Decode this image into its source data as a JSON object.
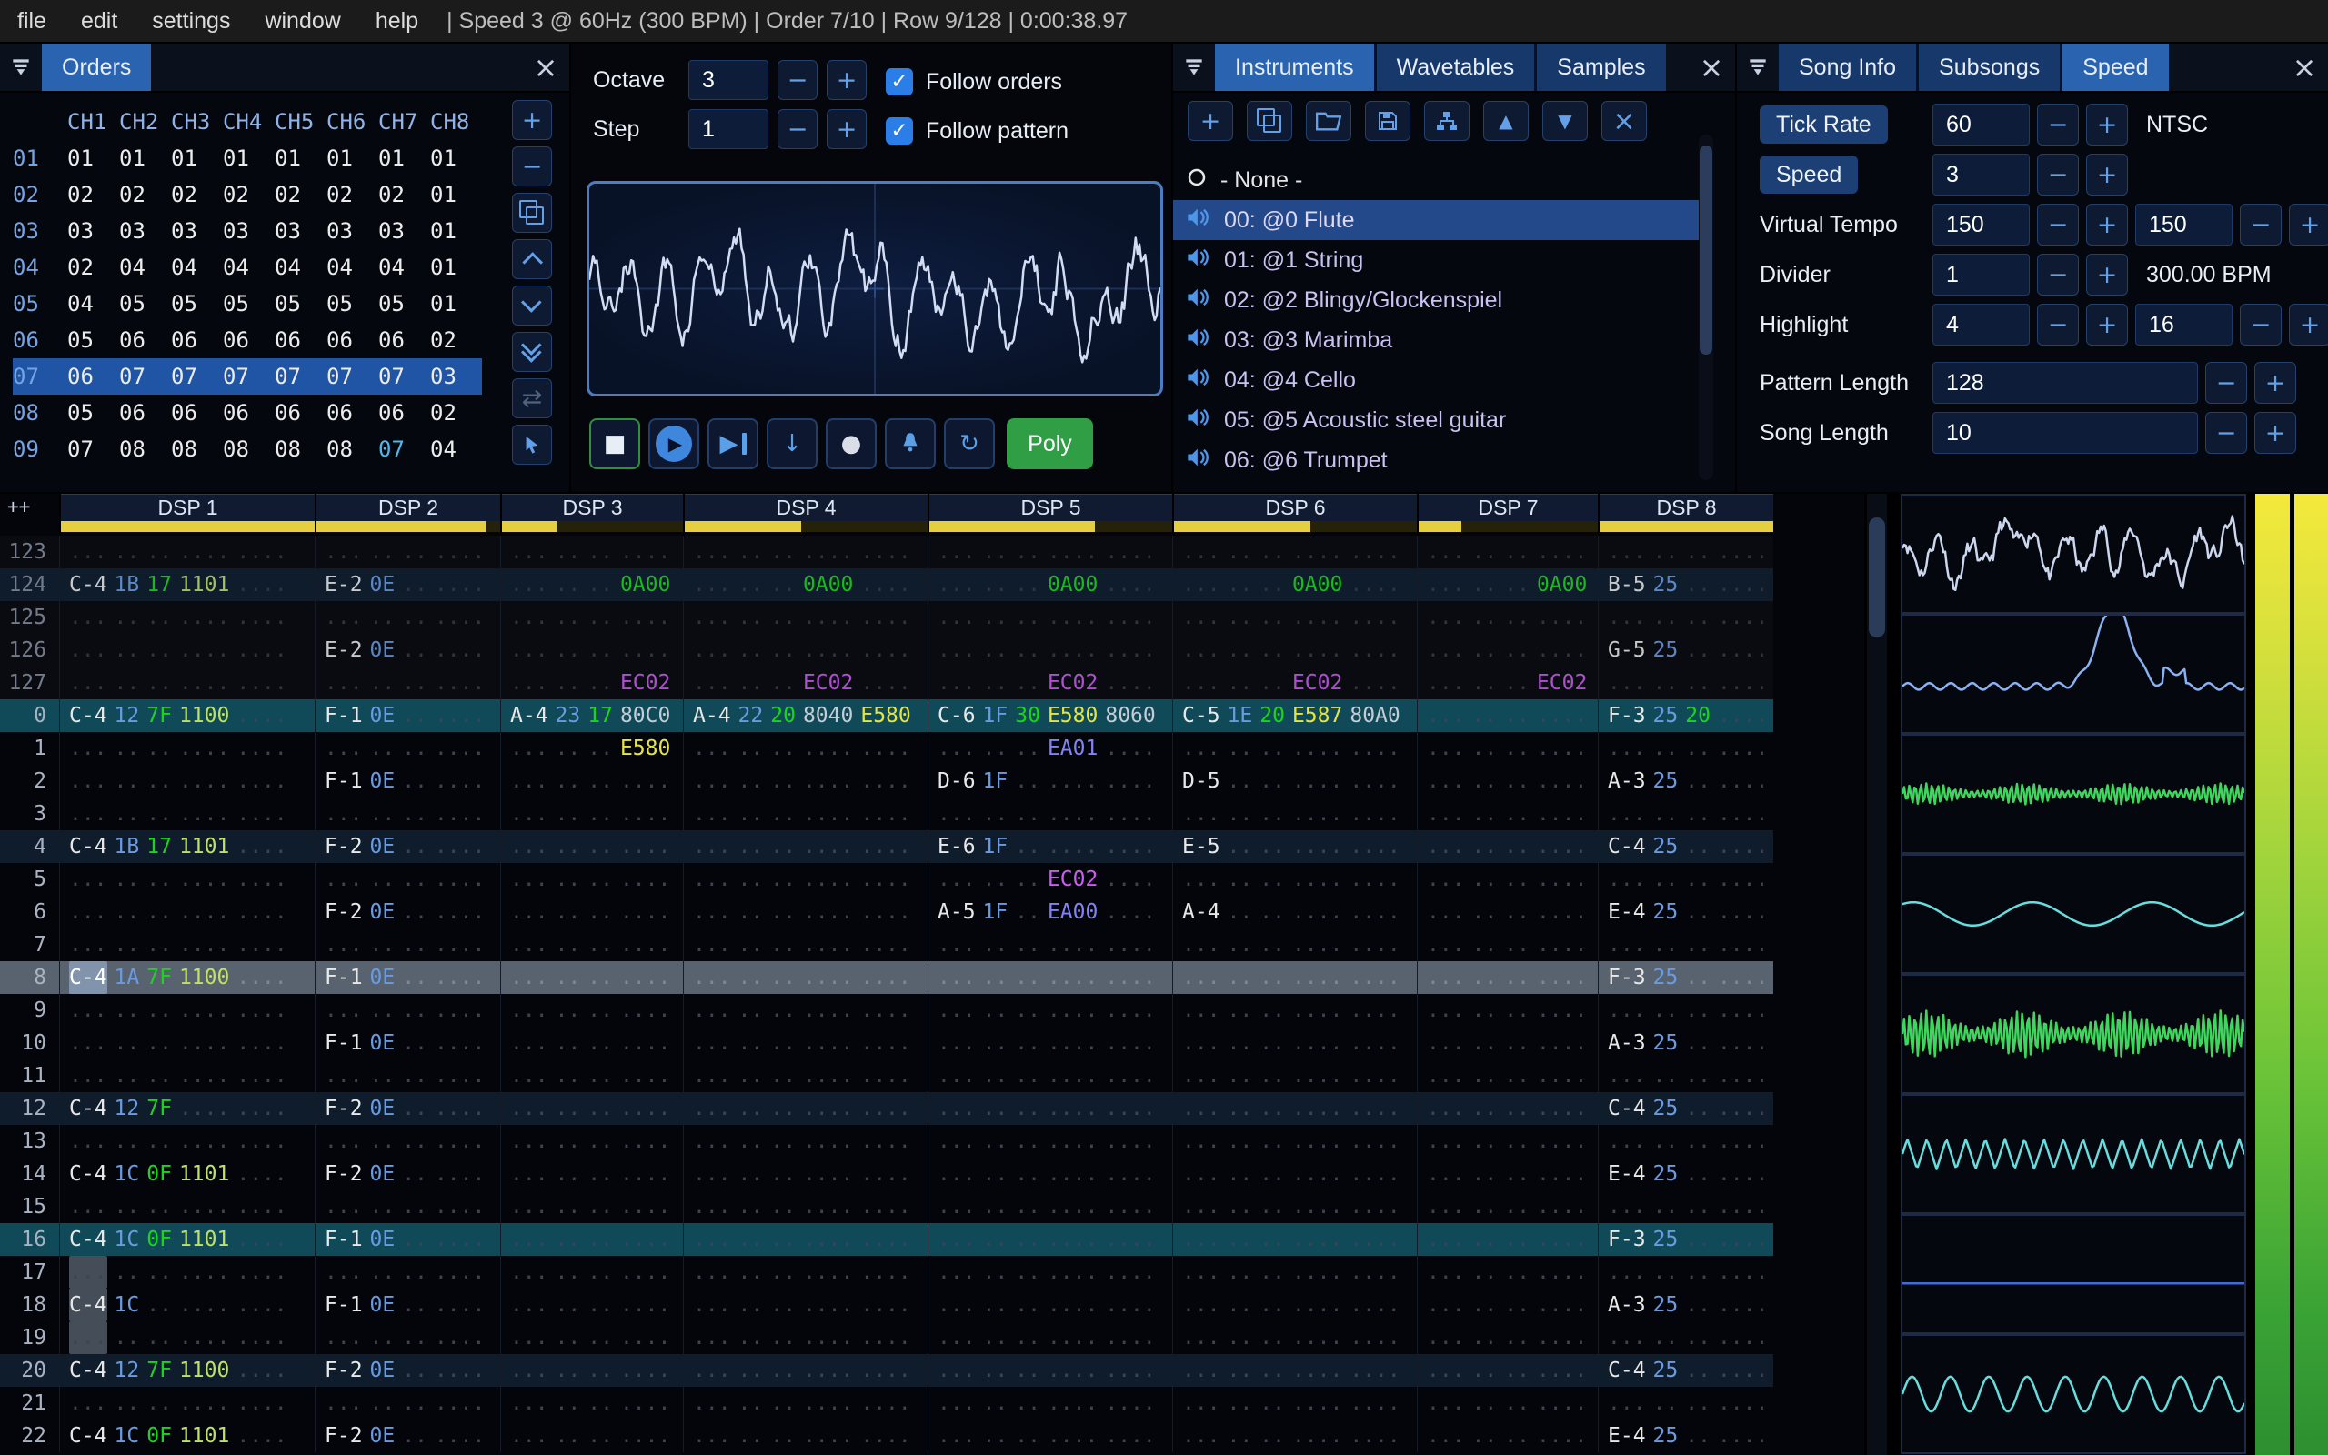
{
  "menu": {
    "items": [
      "file",
      "edit",
      "settings",
      "window",
      "help"
    ],
    "status": "| Speed 3 @ 60Hz (300 BPM) | Order 7/10 | Row 9/128 | 0:00:38.97"
  },
  "glyphs": {
    "plus": "+",
    "minus": "−",
    "check": "✓",
    "close": "×",
    "shuffle": "⇄",
    "up": "▲",
    "down": "▼",
    "stop": "■",
    "play": "▶",
    "step": "↓",
    "record": "●",
    "repeat": "↻"
  },
  "orders": {
    "tabs": [
      "Orders"
    ],
    "active_tab": 0,
    "channels": [
      "CH1",
      "CH2",
      "CH3",
      "CH4",
      "CH5",
      "CH6",
      "CH7",
      "CH8"
    ],
    "rows": [
      {
        "label": "01",
        "values": [
          "01",
          "01",
          "01",
          "01",
          "01",
          "01",
          "01",
          "01"
        ]
      },
      {
        "label": "02",
        "values": [
          "02",
          "02",
          "02",
          "02",
          "02",
          "02",
          "02",
          "01"
        ]
      },
      {
        "label": "03",
        "values": [
          "03",
          "03",
          "03",
          "03",
          "03",
          "03",
          "03",
          "01"
        ]
      },
      {
        "label": "04",
        "values": [
          "02",
          "04",
          "04",
          "04",
          "04",
          "04",
          "04",
          "01"
        ]
      },
      {
        "label": "05",
        "values": [
          "04",
          "05",
          "05",
          "05",
          "05",
          "05",
          "05",
          "01"
        ]
      },
      {
        "label": "06",
        "values": [
          "05",
          "06",
          "06",
          "06",
          "06",
          "06",
          "06",
          "02"
        ]
      },
      {
        "label": "07",
        "values": [
          "06",
          "07",
          "07",
          "07",
          "07",
          "07",
          "07",
          "03"
        ]
      },
      {
        "label": "08",
        "values": [
          "05",
          "06",
          "06",
          "06",
          "06",
          "06",
          "06",
          "02"
        ]
      },
      {
        "label": "09",
        "values": [
          "07",
          "08",
          "08",
          "08",
          "08",
          "08",
          "07",
          "04"
        ]
      }
    ],
    "selected_index": 6,
    "accent_cell": {
      "row": 8,
      "col": 6
    },
    "toolbar": [
      "add-order",
      "remove-order",
      "duplicate-order",
      "move-order-up",
      "move-order-down",
      "duplicate-order-end",
      "randomize-order",
      "order-edit-mode"
    ]
  },
  "playback": {
    "octave_label": "Octave",
    "octave_value": "3",
    "step_label": "Step",
    "step_value": "1",
    "follow_orders_label": "Follow orders",
    "follow_pattern_label": "Follow pattern",
    "poly_label": "Poly"
  },
  "instruments": {
    "tabs": [
      "Instruments",
      "Wavetables",
      "Samples"
    ],
    "active_tab": 0,
    "toolbar": [
      "add-instrument",
      "duplicate-instrument",
      "open-instrument",
      "save-instrument",
      "organize-instruments",
      "move-instrument-up",
      "move-instrument-down",
      "delete-instrument"
    ],
    "items": [
      {
        "name": "- None -",
        "icon": "circle",
        "selected": false
      },
      {
        "name": "00: @0 Flute",
        "icon": "speaker",
        "selected": true
      },
      {
        "name": "01: @1 String",
        "icon": "speaker",
        "selected": false
      },
      {
        "name": "02: @2 Blingy/Glockenspiel",
        "icon": "speaker",
        "selected": false
      },
      {
        "name": "03: @3 Marimba",
        "icon": "speaker",
        "selected": false
      },
      {
        "name": "04: @4 Cello",
        "icon": "speaker",
        "selected": false
      },
      {
        "name": "05: @5 Acoustic steel guitar",
        "icon": "speaker",
        "selected": false
      },
      {
        "name": "06: @6 Trumpet",
        "icon": "speaker",
        "selected": false
      }
    ]
  },
  "song_info": {
    "tabs": [
      "Song Info",
      "Subsongs",
      "Speed"
    ],
    "active_tab": 2,
    "rows": [
      {
        "label": "Tick Rate",
        "style": "button",
        "inputs": [
          "60"
        ],
        "suffix": "NTSC",
        "wide": false
      },
      {
        "label": "Speed",
        "style": "button",
        "inputs": [
          "3"
        ],
        "suffix": "",
        "wide": false
      },
      {
        "label": "Virtual Tempo",
        "style": "plain",
        "inputs": [
          "150",
          "150"
        ],
        "suffix": "",
        "wide": false
      },
      {
        "label": "Divider",
        "style": "plain",
        "inputs": [
          "1"
        ],
        "suffix": "300.00 BPM",
        "wide": false
      },
      {
        "label": "Highlight",
        "style": "plain",
        "inputs": [
          "4",
          "16"
        ],
        "suffix": "",
        "wide": false
      },
      {
        "label": "Pattern Length",
        "style": "plain",
        "inputs": [
          "128"
        ],
        "suffix": "",
        "wide": true
      },
      {
        "label": "Song Length",
        "style": "plain",
        "inputs": [
          "10"
        ],
        "suffix": "",
        "wide": true
      }
    ]
  },
  "pattern": {
    "corner": "++",
    "channels": [
      {
        "name": "DSP 1",
        "meter": 1.0
      },
      {
        "name": "DSP 2",
        "meter": 0.92
      },
      {
        "name": "DSP 3",
        "meter": 0.3
      },
      {
        "name": "DSP 4",
        "meter": 0.48
      },
      {
        "name": "DSP 5",
        "meter": 0.68
      },
      {
        "name": "DSP 6",
        "meter": 0.56
      },
      {
        "name": "DSP 7",
        "meter": 0.24
      },
      {
        "name": "DSP 8",
        "meter": 1.0
      }
    ],
    "rows": [
      {
        "n": "123",
        "prev": true,
        "cells": {}
      },
      {
        "n": "124",
        "prev": true,
        "hl": "min",
        "cells": {
          "0": [
            "C-4",
            "1B",
            "17",
            "1101",
            ""
          ],
          "1": [
            "E-2",
            "0E",
            "",
            ""
          ],
          "2": [
            "",
            "",
            "",
            "0A00"
          ],
          "3": [
            "",
            "",
            "",
            "0A00",
            ""
          ],
          "4": [
            "",
            "",
            "",
            "0A00",
            ""
          ],
          "5": [
            "",
            "",
            "",
            "0A00",
            ""
          ],
          "6": [
            "",
            "",
            "",
            "0A00"
          ],
          "7": [
            "B-5",
            "25",
            "",
            ""
          ]
        }
      },
      {
        "n": "125",
        "prev": true,
        "cells": {}
      },
      {
        "n": "126",
        "prev": true,
        "cells": {
          "1": [
            "E-2",
            "0E",
            "",
            ""
          ],
          "7": [
            "G-5",
            "25",
            "",
            ""
          ]
        }
      },
      {
        "n": "127",
        "prev": true,
        "cells": {
          "2": [
            "",
            "",
            "",
            "EC02"
          ],
          "3": [
            "",
            "",
            "",
            "EC02",
            ""
          ],
          "4": [
            "",
            "",
            "",
            "EC02",
            ""
          ],
          "5": [
            "",
            "",
            "",
            "EC02",
            ""
          ],
          "6": [
            "",
            "",
            "",
            "EC02"
          ]
        }
      },
      {
        "n": "0",
        "hl": "maj",
        "cells": {
          "0": [
            "C-4",
            "12",
            "7F",
            "1100",
            ""
          ],
          "1": [
            "F-1",
            "0E",
            "",
            ""
          ],
          "2": [
            "A-4",
            "23",
            "17",
            "80C0"
          ],
          "3": [
            "A-4",
            "22",
            "20",
            "8040",
            "E580"
          ],
          "4": [
            "C-6",
            "1F",
            "30",
            "E580",
            "8060"
          ],
          "5": [
            "C-5",
            "1E",
            "20",
            "E587",
            "80A0"
          ],
          "7": [
            "F-3",
            "25",
            "20",
            ""
          ]
        }
      },
      {
        "n": "1",
        "cells": {
          "2": [
            "",
            "",
            "",
            "E580"
          ],
          "4": [
            "",
            "",
            "",
            "EA01",
            ""
          ]
        }
      },
      {
        "n": "2",
        "cells": {
          "1": [
            "F-1",
            "0E",
            "",
            ""
          ],
          "4": [
            "D-6",
            "1F",
            "",
            "",
            ""
          ],
          "5": [
            "D-5",
            "",
            "",
            "",
            ""
          ],
          "7": [
            "A-3",
            "25",
            "",
            ""
          ]
        }
      },
      {
        "n": "3",
        "cells": {}
      },
      {
        "n": "4",
        "hl": "min",
        "cells": {
          "0": [
            "C-4",
            "1B",
            "17",
            "1101",
            ""
          ],
          "1": [
            "F-2",
            "0E",
            "",
            ""
          ],
          "4": [
            "E-6",
            "1F",
            "",
            "",
            ""
          ],
          "5": [
            "E-5",
            "",
            "",
            "",
            ""
          ],
          "7": [
            "C-4",
            "25",
            "",
            ""
          ]
        }
      },
      {
        "n": "5",
        "cells": {
          "4": [
            "",
            "",
            "",
            "EC02",
            ""
          ]
        }
      },
      {
        "n": "6",
        "cells": {
          "1": [
            "F-2",
            "0E",
            "",
            ""
          ],
          "4": [
            "A-5",
            "1F",
            "",
            "EA00",
            ""
          ],
          "5": [
            "A-4",
            "",
            "",
            "",
            ""
          ],
          "7": [
            "E-4",
            "25",
            "",
            ""
          ]
        }
      },
      {
        "n": "7",
        "cells": {}
      },
      {
        "n": "8",
        "hl": "play",
        "cursor": [
          0,
          0
        ],
        "cells": {
          "0": [
            "C-4",
            "1A",
            "7F",
            "1100",
            ""
          ],
          "1": [
            "F-1",
            "0E",
            "",
            ""
          ],
          "7": [
            "F-3",
            "25",
            "",
            ""
          ]
        }
      },
      {
        "n": "9",
        "cells": {}
      },
      {
        "n": "10",
        "cells": {
          "1": [
            "F-1",
            "0E",
            "",
            ""
          ],
          "7": [
            "A-3",
            "25",
            "",
            ""
          ]
        }
      },
      {
        "n": "11",
        "cells": {}
      },
      {
        "n": "12",
        "hl": "min",
        "cells": {
          "0": [
            "C-4",
            "12",
            "7F",
            "",
            ""
          ],
          "1": [
            "F-2",
            "0E",
            "",
            ""
          ],
          "7": [
            "C-4",
            "25",
            "",
            ""
          ]
        }
      },
      {
        "n": "13",
        "cells": {}
      },
      {
        "n": "14",
        "cells": {
          "0": [
            "C-4",
            "1C",
            "0F",
            "1101",
            ""
          ],
          "1": [
            "F-2",
            "0E",
            "",
            ""
          ],
          "7": [
            "E-4",
            "25",
            "",
            ""
          ]
        }
      },
      {
        "n": "15",
        "cells": {}
      },
      {
        "n": "16",
        "hl": "maj",
        "cells": {
          "0": [
            "C-4",
            "1C",
            "0F",
            "1101",
            ""
          ],
          "1": [
            "F-1",
            "0E",
            "",
            ""
          ],
          "7": [
            "F-3",
            "25",
            "",
            ""
          ]
        }
      },
      {
        "n": "17",
        "sel": true,
        "cells": {}
      },
      {
        "n": "18",
        "sel": true,
        "cells": {
          "0": [
            "C-4",
            "1C",
            "",
            "",
            ""
          ],
          "1": [
            "F-1",
            "0E",
            "",
            ""
          ],
          "7": [
            "A-3",
            "25",
            "",
            ""
          ]
        }
      },
      {
        "n": "19",
        "sel": true,
        "cells": {}
      },
      {
        "n": "20",
        "hl": "min",
        "cells": {
          "0": [
            "C-4",
            "12",
            "7F",
            "1100",
            ""
          ],
          "1": [
            "F-2",
            "0E",
            "",
            ""
          ],
          "7": [
            "C-4",
            "25",
            "",
            ""
          ]
        }
      },
      {
        "n": "21",
        "cells": {}
      },
      {
        "n": "22",
        "cells": {
          "0": [
            "C-4",
            "1C",
            "0F",
            "1101",
            ""
          ],
          "1": [
            "F-2",
            "0E",
            "",
            ""
          ],
          "7": [
            "E-4",
            "25",
            "",
            ""
          ]
        }
      }
    ]
  },
  "colors": {
    "note": "#e8e8e8",
    "ins": "#6a9be0",
    "vol": "#1ad61a",
    "fx": {
      "0A": "#1ad61a",
      "EC": "#cb5cf2",
      "E5": "#e5e542",
      "EA": "#8282f5",
      "80": "#c4ccd6",
      "11": "#bfe06a"
    },
    "fx_default": "#cccccc",
    "accent": "#52b7e6"
  },
  "scopes": [
    {
      "channel": "DSP 1",
      "style": "complex",
      "color": "#ccd6ec",
      "amp": 0.3
    },
    {
      "channel": "DSP 2",
      "style": "envelope",
      "color": "#8ab2f2",
      "amp": 0.36
    },
    {
      "channel": "DSP 3",
      "style": "dense",
      "color": "#3ed65c",
      "amp": 0.09
    },
    {
      "channel": "DSP 4",
      "style": "lowsine",
      "color": "#66dede",
      "amp": 0.1
    },
    {
      "channel": "DSP 5",
      "style": "dense",
      "color": "#3ed65c",
      "amp": 0.2
    },
    {
      "channel": "DSP 6",
      "style": "zigzag",
      "color": "#66dede",
      "amp": 0.13
    },
    {
      "channel": "DSP 7",
      "style": "flat",
      "color": "#3f6cd8",
      "amp": 0.08
    },
    {
      "channel": "DSP 8",
      "style": "sine",
      "color": "#66dede",
      "amp": 0.15
    }
  ],
  "meter": {
    "gradient": [
      "#f4e93c",
      "#d8e03c",
      "#a8d63c",
      "#6cc438",
      "#3aa335",
      "#2d8f30"
    ]
  }
}
